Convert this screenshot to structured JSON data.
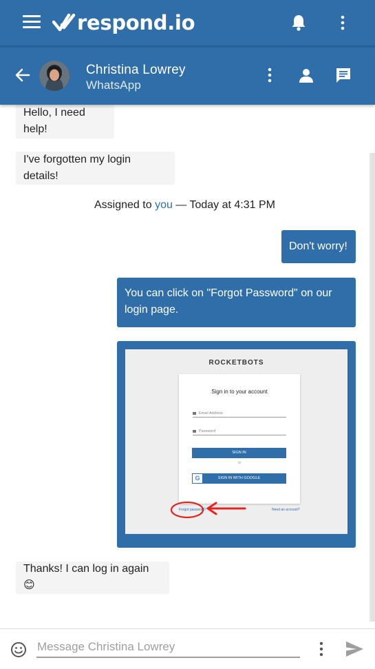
{
  "app": {
    "brand": "respond.io"
  },
  "header": {
    "icons": [
      "menu-icon",
      "logo-check-icon",
      "bell-icon",
      "more-vertical-icon"
    ],
    "colors": {
      "primary": "#2f6ea8"
    }
  },
  "contact": {
    "name": "Christina Lowrey",
    "channel": "WhatsApp",
    "icons": [
      "back-arrow-icon",
      "more-vertical-icon",
      "person-icon",
      "chat-icon"
    ]
  },
  "messages": [
    {
      "direction": "incoming",
      "text": "Hello, I need help!"
    },
    {
      "direction": "incoming",
      "text": "I've forgotten my login details!"
    },
    {
      "direction": "outgoing",
      "text": "Don't worry!"
    },
    {
      "direction": "outgoing",
      "text": "You can click on \"Forgot Password\" on our login page."
    },
    {
      "direction": "incoming",
      "text": "Thanks! I can log in again 😊"
    }
  ],
  "system": {
    "prefix": "Assigned to ",
    "assignee": "you",
    "suffix": " — Today at 4:31 PM"
  },
  "image_preview": {
    "brand": "ROCKETBOTS",
    "title": "Sign in to your account",
    "email_placeholder": "Email Address",
    "password_placeholder": "Password",
    "signin_button": "SIGN IN",
    "or": "or",
    "google_button": "SIGN IN WITH GOOGLE",
    "forgot_link": "Forgot password?",
    "account_link": "Need an account?",
    "annotation_color": "#e52420"
  },
  "composer": {
    "placeholder": "Message Christina Lowrey",
    "value": "",
    "icons": [
      "emoji-icon",
      "more-vertical-icon",
      "send-icon"
    ]
  }
}
